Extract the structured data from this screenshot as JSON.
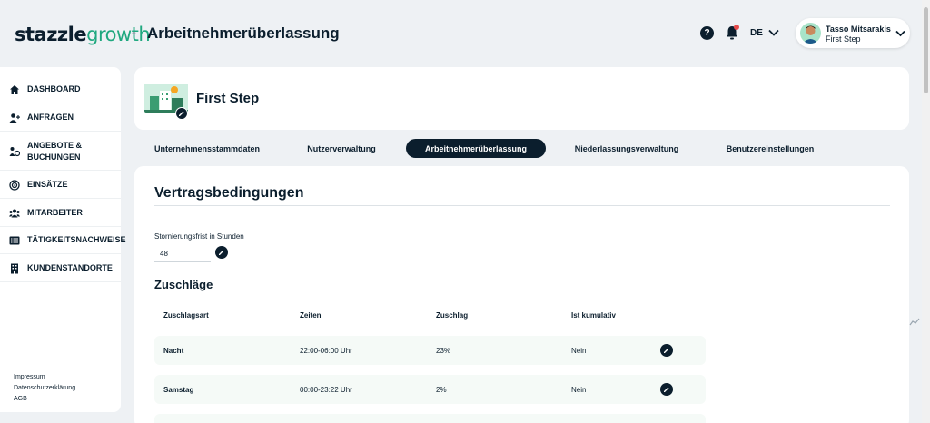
{
  "header": {
    "logo_part1": "stazzle",
    "logo_part2": "growth",
    "separator": "•",
    "title": "Arbeitnehmerüberlassung",
    "help_symbol": "?",
    "language": "DE",
    "user": {
      "name": "Tasso Mitsarakis",
      "company": "First Step"
    }
  },
  "sidebar": {
    "items": [
      {
        "label": "DASHBOARD",
        "icon": "home-icon"
      },
      {
        "label": "ANFRAGEN",
        "icon": "user-plus-icon"
      },
      {
        "label": "ANGEBOTE &",
        "label2": "BUCHUNGEN",
        "icon": "offers-icon"
      },
      {
        "label": "EINSÄTZE",
        "icon": "target-icon"
      },
      {
        "label": "MITARBEITER",
        "icon": "users-icon"
      },
      {
        "label": "TÄTIGKEITSNACHWEISE",
        "icon": "list-icon"
      },
      {
        "label": "KUNDENSTANDORTE",
        "icon": "building-icon"
      }
    ],
    "footer": [
      "Impressum",
      "Datenschutzerklärung",
      "AGB"
    ]
  },
  "company": {
    "name": "First Step"
  },
  "tabs": [
    {
      "label": "Unternehmensstammdaten"
    },
    {
      "label": "Nutzerverwaltung"
    },
    {
      "label": "Arbeitnehmerüberlassung",
      "active": true
    },
    {
      "label": "Niederlassungsverwaltung"
    },
    {
      "label": "Benutzereinstellungen"
    }
  ],
  "contract": {
    "title": "Vertragsbedingungen",
    "cancellation_label": "Stornierungsfrist in Stunden",
    "cancellation_value": "48"
  },
  "surcharges": {
    "title": "Zuschläge",
    "columns": [
      "Zuschlagsart",
      "Zeiten",
      "Zuschlag",
      "Ist kumulativ"
    ],
    "rows": [
      {
        "type": "Nacht",
        "times": "22:00-06:00 Uhr",
        "surcharge": "23%",
        "cumulative": "Nein"
      },
      {
        "type": "Samstag",
        "times": "00:00-23:22 Uhr",
        "surcharge": "2%",
        "cumulative": "Nein"
      }
    ]
  },
  "colors": {
    "primary": "#0b1e2d",
    "accent": "#1fa87f",
    "row_bg": "#f5faf7",
    "notification": "#e54b4b"
  }
}
